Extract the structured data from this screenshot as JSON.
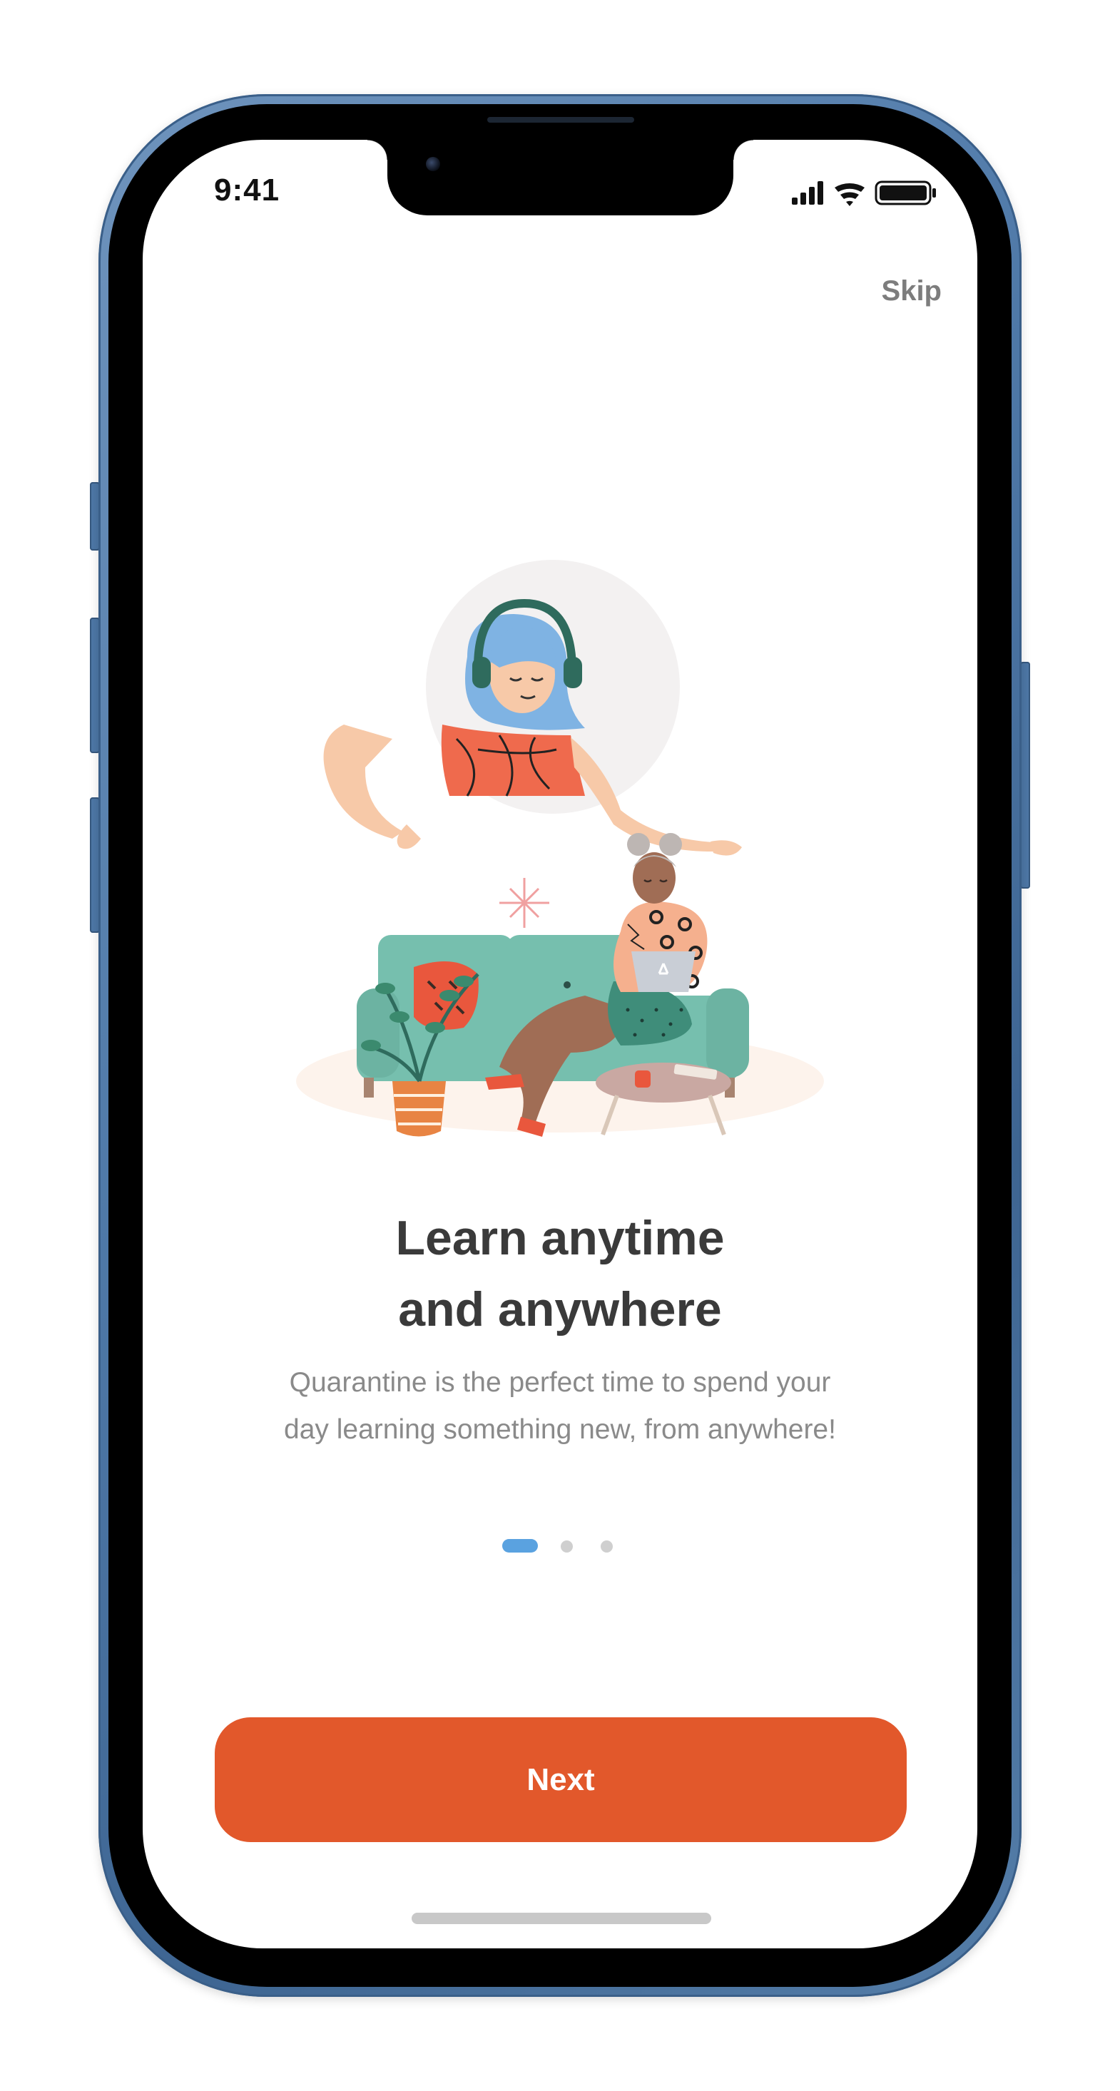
{
  "status_bar": {
    "time": "9:41",
    "icons": [
      "cellular-signal-icon",
      "wifi-icon",
      "battery-icon"
    ]
  },
  "header": {
    "skip_label": "Skip"
  },
  "onboarding": {
    "illustration": "woman-with-headphones-and-woman-on-sofa-with-laptop",
    "title_line1": "Learn anytime",
    "title_line2": "and anywhere",
    "subtitle_line1": "Quarantine is the perfect time to spend your",
    "subtitle_line2": "day learning something new, from anywhere!"
  },
  "pager": {
    "total": 3,
    "active_index": 1
  },
  "actions": {
    "next_label": "Next"
  },
  "colors": {
    "primary": "#e2582b",
    "pager_active": "#5aa2e0",
    "pager_inactive": "#cfcfcf",
    "title": "#3a3a3a",
    "body_text": "#8a8a8a",
    "skip_text": "#7d7d7d",
    "phone_frame": "#4f79a8"
  }
}
